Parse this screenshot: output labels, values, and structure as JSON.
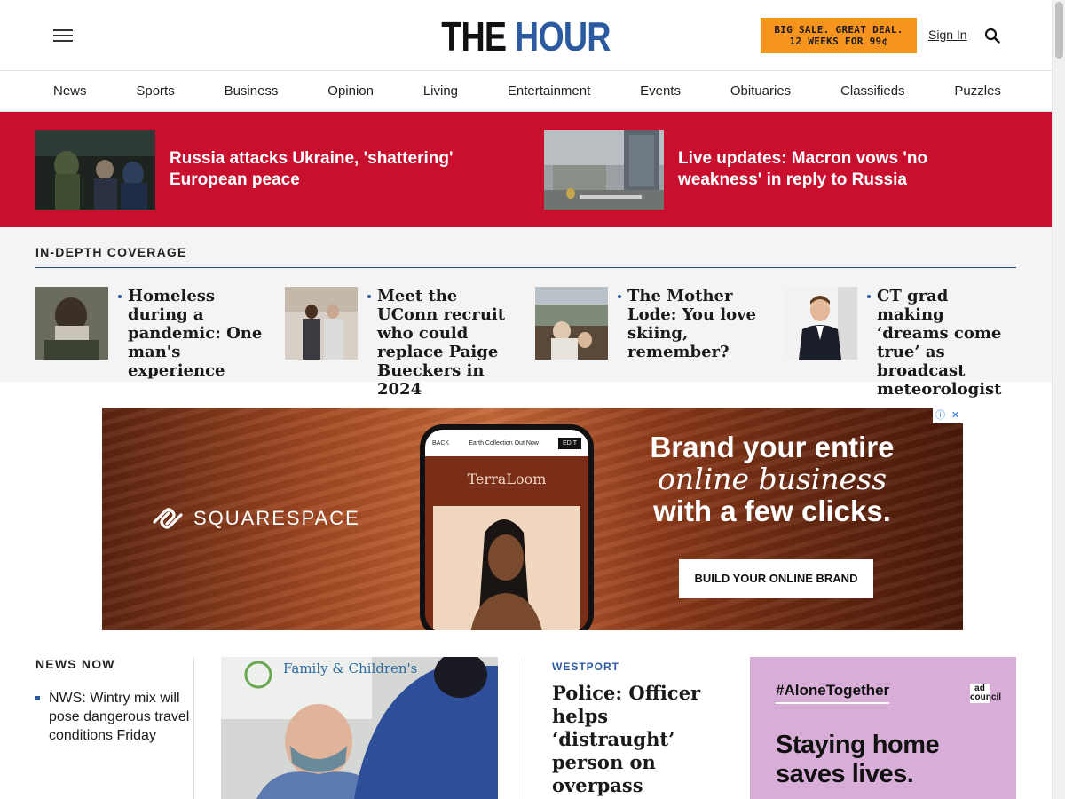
{
  "header": {
    "logo_left": "THE",
    "logo_right": "HOUR",
    "promo_line1": "BIG SALE. GREAT DEAL.",
    "promo_line2": "12 WEEKS FOR 99¢",
    "signin_label": "Sign In"
  },
  "nav": {
    "items": [
      "News",
      "Sports",
      "Business",
      "Opinion",
      "Living",
      "Entertainment",
      "Events",
      "Obituaries",
      "Classifieds",
      "Puzzles"
    ]
  },
  "breaking": {
    "items": [
      {
        "title": "Russia attacks Ukraine, 'shattering' European peace"
      },
      {
        "title": "Live updates: Macron vows 'no weakness' in reply to Russia"
      }
    ]
  },
  "indepth": {
    "heading": "IN-DEPTH COVERAGE",
    "stories": [
      {
        "title": "Homeless during a pandemic: One man's experience"
      },
      {
        "title": "Meet the UConn recruit who could replace Paige Bueckers in 2024"
      },
      {
        "title": "The Mother Lode: You love skiing, remember?"
      },
      {
        "title": "CT grad making ‘dreams come true’ as broadcast meteorologist"
      }
    ]
  },
  "ad": {
    "brand": "SQUARESPACE",
    "phone_back": "BACK",
    "phone_caption": "Earth Collection Out Now",
    "phone_edit": "EDIT",
    "phone_site": "TerraLoom",
    "headline_1": "Brand your entire",
    "headline_2": "online business",
    "headline_3": "with a few clicks.",
    "cta": "BUILD YOUR ONLINE BRAND"
  },
  "news_now": {
    "heading": "NEWS NOW",
    "items": [
      {
        "title": "NWS: Wintry mix will pose dangerous travel conditions Friday"
      }
    ]
  },
  "main_photo": {
    "sign_text": "Family & Children's"
  },
  "feature": {
    "kicker": "WESTPORT",
    "title": "Police: Officer helps ‘distraught’ person on overpass"
  },
  "psa": {
    "tag": "#AloneTogether",
    "logo": "ad council",
    "message_1": "Staying home",
    "message_2": "saves lives."
  }
}
